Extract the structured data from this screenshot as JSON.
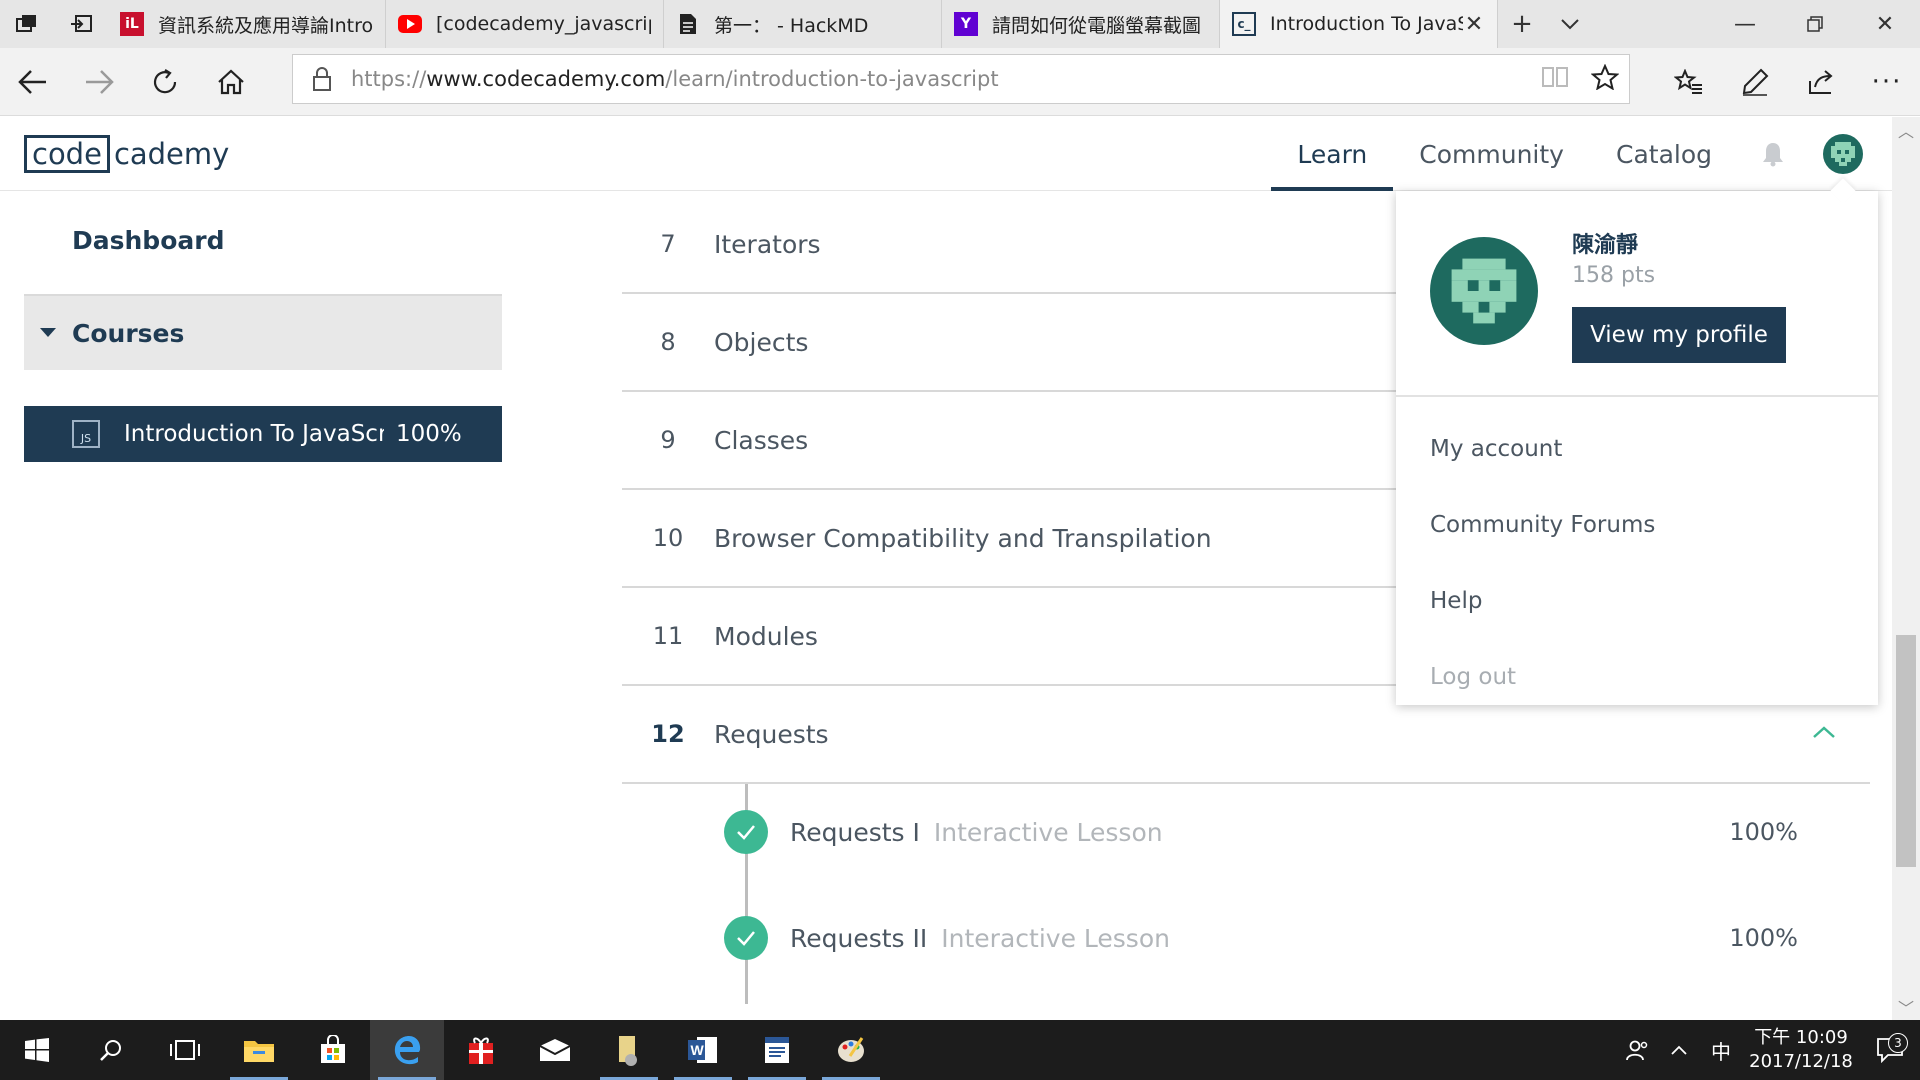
{
  "browser": {
    "tabs": [
      {
        "title": "資訊系統及應用導論Intro.",
        "icon": "ilearn-icon",
        "color": "#c8102e"
      },
      {
        "title": "[codecademy_javascript] Ir",
        "icon": "youtube-icon",
        "color": "#ff0000"
      },
      {
        "title": "第一：  - HackMD",
        "icon": "document-icon",
        "color": "#222222"
      },
      {
        "title": "請問如何從電腦螢幕截圖 '",
        "icon": "yahoo-icon",
        "color": "#6001d2"
      },
      {
        "title": "Introduction To JavaSc",
        "icon": "codecademy-icon",
        "color": "#1f3b53"
      }
    ],
    "url_prefix": "https://",
    "url_host": "www.codecademy.com",
    "url_path": "/learn/introduction-to-javascript"
  },
  "site": {
    "logo_boxed": "code",
    "logo_tail": "cademy",
    "nav": {
      "learn": "Learn",
      "community": "Community",
      "catalog": "Catalog"
    }
  },
  "sidebar": {
    "dashboard": "Dashboard",
    "courses_label": "Courses",
    "course": {
      "icon_text": "JS",
      "title": "Introduction To JavaScr...",
      "percent": "100%"
    }
  },
  "units": [
    {
      "number": "7",
      "name": "Iterators"
    },
    {
      "number": "8",
      "name": "Objects"
    },
    {
      "number": "9",
      "name": "Classes"
    },
    {
      "number": "10",
      "name": "Browser Compatibility and Transpilation"
    },
    {
      "number": "11",
      "name": "Modules"
    },
    {
      "number": "12",
      "name": "Requests"
    }
  ],
  "lessons": [
    {
      "name": "Requests I",
      "type": "Interactive Lesson",
      "percent": "100%"
    },
    {
      "name": "Requests II",
      "type": "Interactive Lesson",
      "percent": "100%"
    }
  ],
  "profile": {
    "name": "陳渝靜",
    "points": "158 pts",
    "view_profile": "View my profile",
    "menu": {
      "account": "My account",
      "forums": "Community Forums",
      "help": "Help",
      "logout": "Log out"
    }
  },
  "taskbar": {
    "time": "下午 10:09",
    "date": "2017/12/18",
    "ime": "中",
    "notifications": "3"
  },
  "colors": {
    "brand_navy": "#1f3b53",
    "complete_green": "#3db893",
    "avatar_green": "#1e6a5f"
  }
}
